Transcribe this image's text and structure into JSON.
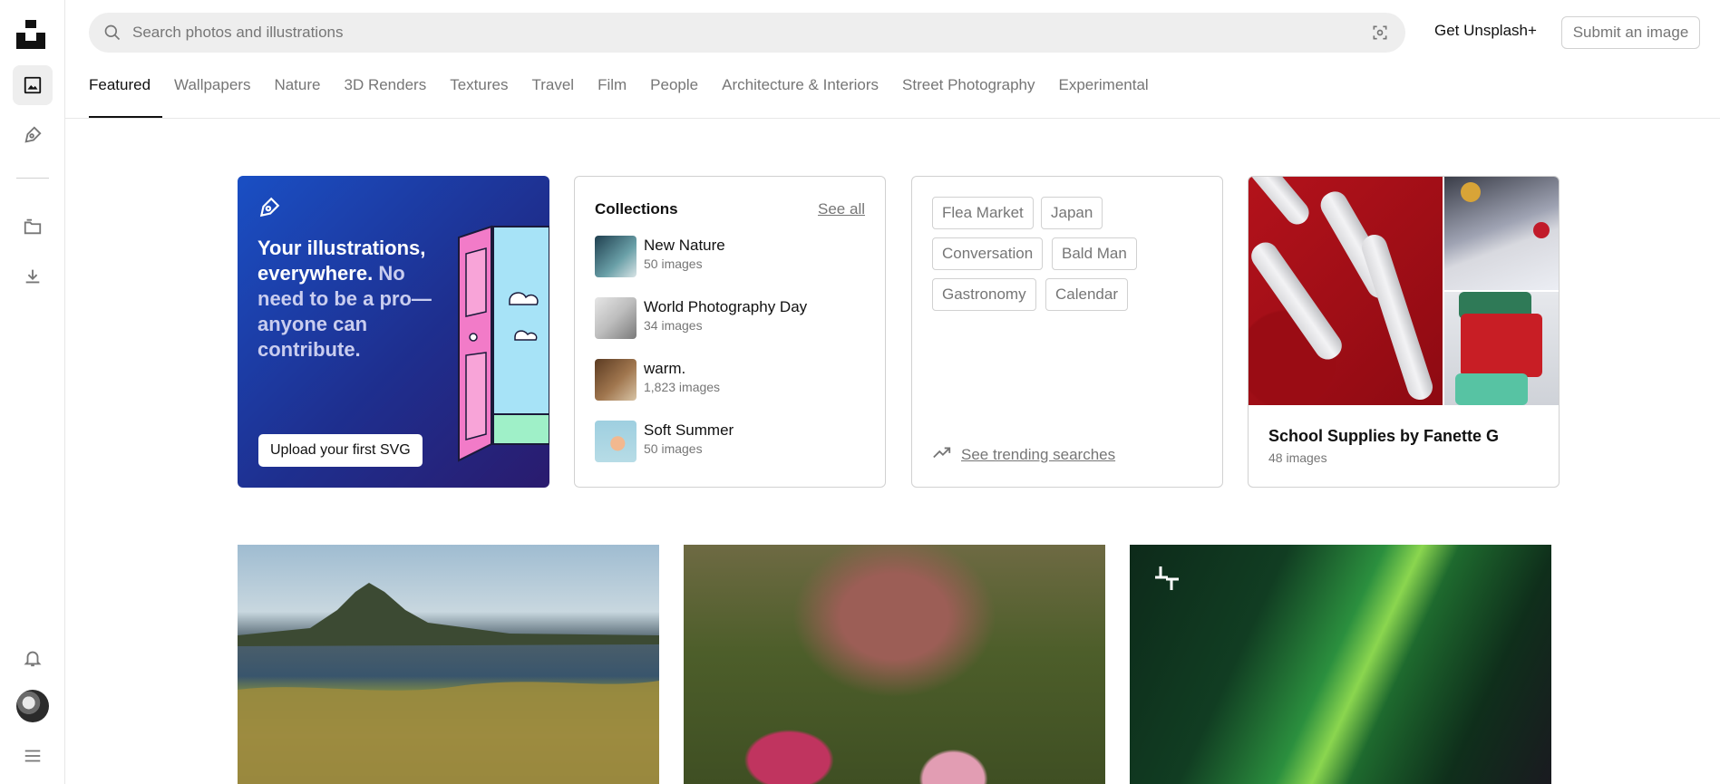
{
  "search": {
    "placeholder": "Search photos and illustrations"
  },
  "header": {
    "get_plus": "Get Unsplash+",
    "submit": "Submit an image"
  },
  "tabs": [
    {
      "label": "Featured"
    },
    {
      "label": "Wallpapers"
    },
    {
      "label": "Nature"
    },
    {
      "label": "3D Renders"
    },
    {
      "label": "Textures"
    },
    {
      "label": "Travel"
    },
    {
      "label": "Film"
    },
    {
      "label": "People"
    },
    {
      "label": "Architecture & Interiors"
    },
    {
      "label": "Street Photography"
    },
    {
      "label": "Experimental"
    }
  ],
  "rail": {
    "icons": [
      "unsplash-logo",
      "photos-icon",
      "pen-icon",
      "collections-icon",
      "download-icon",
      "bell-icon",
      "avatar",
      "menu-icon"
    ]
  },
  "promo": {
    "headline_strong": "Your illustrations, everywhere.",
    "headline_dim": " No need to be a pro—anyone can contribute.",
    "button": "Upload your first SVG"
  },
  "collections": {
    "title": "Collections",
    "see_all": "See all",
    "items": [
      {
        "title": "New Nature",
        "count": "50 images",
        "thumb_color": "#2f5a6b"
      },
      {
        "title": "World Photography Day",
        "count": "34 images",
        "thumb_color": "#cfcfcf"
      },
      {
        "title": "warm.",
        "count": "1,823 images",
        "thumb_color": "#8a5e3a"
      },
      {
        "title": "Soft Summer",
        "count": "50 images",
        "thumb_color": "#9cc3d0"
      }
    ]
  },
  "trending": {
    "tags": [
      "Flea Market",
      "Japan",
      "Conversation",
      "Bald Man",
      "Gastronomy",
      "Calendar"
    ],
    "link": "See trending searches"
  },
  "featured_collection": {
    "title": "School Supplies by Fanette G",
    "count": "48 images"
  },
  "colors": {
    "accent": "#111111",
    "muted": "#767676",
    "border": "#d1d1d1",
    "promo_blue": "#1e3fa8"
  }
}
